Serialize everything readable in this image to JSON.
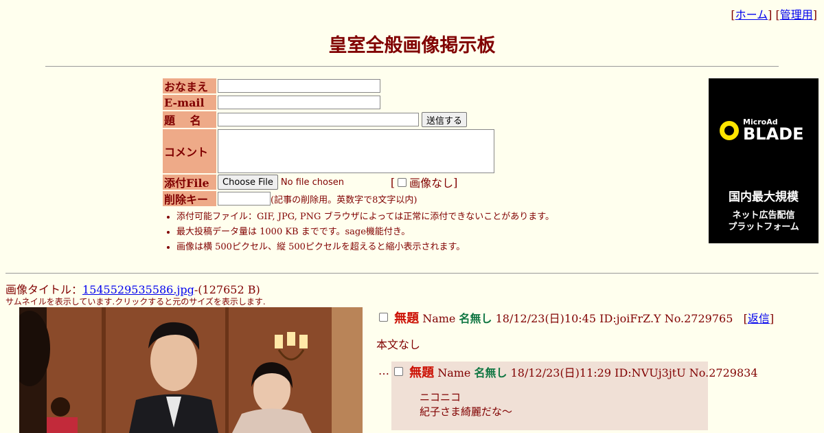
{
  "nav": {
    "open": "[",
    "home": "ホーム",
    "mid": "] [",
    "admin": "管理用",
    "close": "]"
  },
  "title": "皇室全般画像掲示板",
  "form": {
    "name_label": "おなまえ",
    "email_label": "E-mail",
    "subject_label": "題　 名",
    "submit": "送信する",
    "comment_label": "コメント",
    "file_label": "添付File",
    "choose_file": "Choose File",
    "no_file": "No file chosen",
    "noimage_open": "[",
    "noimage": "画像なし",
    "noimage_close": "]",
    "delkey_label": "削除キー",
    "delkey_note": "(記事の削除用。英数字で8文字以内)",
    "notes": [
      "添付可能ファイル：GIF, JPG, PNG ブラウザによっては正常に添付できないことがあります。",
      "最大投稿データ量は 1000 KB までです。sage機能付き。",
      "画像は横 500ピクセル、縦 500ピクセルを超えると縮小表示されます。"
    ]
  },
  "ad": {
    "small": "MicroAd",
    "brand": "BLADE",
    "line1": "国内最大規模",
    "line2": "ネット広告配信",
    "line3": "プラットフォーム"
  },
  "thread": {
    "image_title_label": "画像タイトル：",
    "image_file": "1545529535586.jpg",
    "image_size": "-(127652 B)",
    "thumb_note": "サムネイルを表示しています.クリックすると元のサイズを表示します.",
    "op": {
      "subject": "無題",
      "name_label": "Name",
      "name": "名無し",
      "meta": "18/12/23(日)10:45 ID:joiFrZ.Y No.2729765",
      "reply_open": "[",
      "reply": "返信",
      "reply_close": "]",
      "body": "本文なし"
    },
    "reply": {
      "prefix": "…",
      "subject": "無題",
      "name_label": "Name",
      "name": "名無し",
      "meta": "18/12/23(日)11:29 ID:NVUj3jtU No.2729834",
      "lines": [
        "ニコニコ",
        "紀子さま綺麗だな～"
      ]
    }
  }
}
